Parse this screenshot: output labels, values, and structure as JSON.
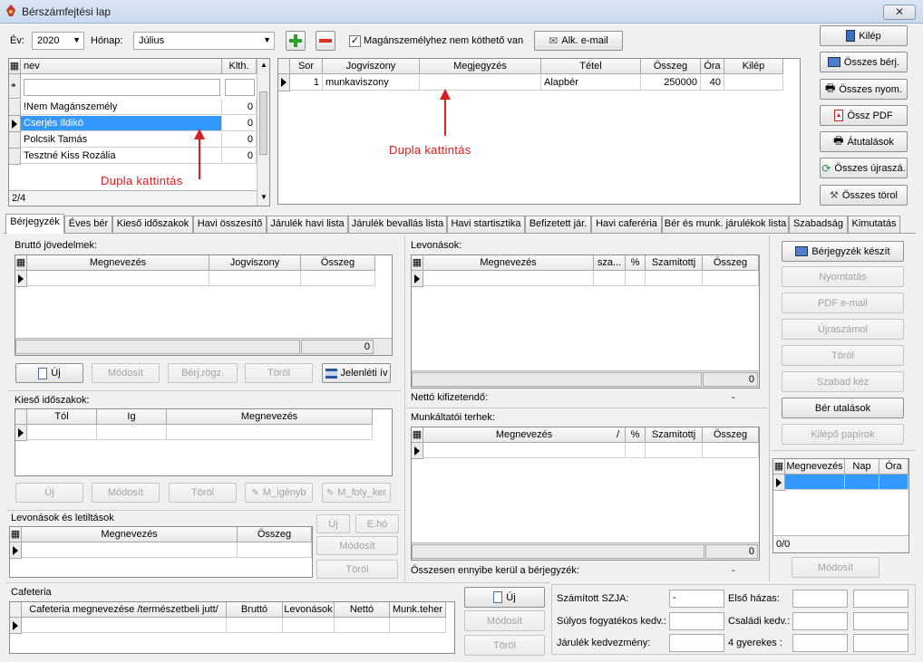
{
  "window": {
    "title": "Bérszámfejtési lap",
    "close_label": "✕"
  },
  "top": {
    "year_label": "Év:",
    "year_value": "2020",
    "month_label": "Hónap:",
    "month_value": "Július",
    "checkbox_label": "Magánszemélyhez nem köthető van",
    "email_button": "Alk. e-mail"
  },
  "right_buttons": {
    "exit": "Kilép",
    "all_payslips": "Összes bérj.",
    "all_print": "Összes nyom.",
    "all_pdf": "Össz PDF",
    "transfers": "Átutalások",
    "all_recalc": "Összes újraszá.",
    "all_delete": "Összes törol"
  },
  "employees": {
    "columns": [
      "nev",
      "Klth."
    ],
    "rows": [
      {
        "name": "!Nem Magánszemély",
        "klth": "0"
      },
      {
        "name": "Cserjés Ildikó",
        "klth": "0"
      },
      {
        "name": "Polcsik Tamás",
        "klth": "0"
      },
      {
        "name": "Tesztné Kiss Rozália",
        "klth": "0"
      }
    ],
    "footer": "2/4"
  },
  "items": {
    "columns": [
      "Sor",
      "Jogviszony",
      "Megjegyzés",
      "Tétel",
      "Összeg",
      "Óra",
      "Kilép"
    ],
    "rows": [
      {
        "sor": "1",
        "jogviszony": "munkaviszony",
        "megjegyzes": "",
        "tetel": "Alapbér",
        "osszeg": "250000",
        "ora": "40",
        "kilep": ""
      }
    ]
  },
  "annotations": {
    "left": "Dupla kattintás",
    "right": "Dupla kattintás"
  },
  "tabs": [
    "Bérjegyzék",
    "Éves bér",
    "Kieső időszakok",
    "Havi összesítő",
    "Járulék havi lista",
    "Járulék bevallás lista",
    "Havi startisztika",
    "Befizetett jár.",
    "Havi caferéria",
    "Bér és munk. járulékok lista",
    "Szabadság",
    "Kimutatás"
  ],
  "gross": {
    "title": "Bruttó jövedelmek:",
    "columns": [
      "Megnevezés",
      "Jogviszony",
      "Összeg"
    ],
    "total": "0",
    "buttons": {
      "new": "Új",
      "modify": "Módosít",
      "berj": "Bérj.rögz.",
      "delete": "Töröl",
      "attendance": "Jelenléti ív"
    }
  },
  "absence": {
    "title": "Kieső időszakok:",
    "columns": [
      "Tól",
      "Ig",
      "Megnevezés"
    ],
    "buttons": {
      "new": "Új",
      "modify": "Módosít",
      "delete": "Töröl",
      "m_igeny": "M_igényb",
      "m_foly": "M_foly_ker"
    }
  },
  "deduct_small": {
    "title": "Levonások és letiltások",
    "columns": [
      "Megnevezés",
      "Összeg"
    ],
    "buttons": {
      "new": "Új",
      "eho": "E.hó",
      "modify": "Módosít",
      "delete": "Töröl"
    }
  },
  "cafeteria": {
    "title": "Cafeteria",
    "columns": [
      "Cafeteria megnevezése /természetbeli jutt/",
      "Bruttó",
      "Levonások",
      "Nettó",
      "Munk.teher"
    ],
    "buttons": {
      "new": "Új",
      "modify": "Módosít",
      "delete": "Töröl"
    }
  },
  "deductions": {
    "title": "Levonások:",
    "columns": [
      "Megnevezés",
      "sza...",
      "%",
      "Szamitottj",
      "Összeg"
    ],
    "total": "0",
    "net_label": "Nettó kifizetendő:",
    "net_value": "-"
  },
  "employer": {
    "title": "Munkáltatói terhek:",
    "columns": [
      "Megnevezés",
      "/",
      "%",
      "Szamitottj",
      "Összeg"
    ],
    "total": "0",
    "sum_label": "Összesen ennyibe kerül a bérjegyzék:",
    "sum_value": "-"
  },
  "actions": {
    "create": "Bérjegyzék készít",
    "print": "Nyomtatás",
    "pdf_email": "PDF e-mail",
    "recalc": "Újraszámol",
    "delete": "Töröl",
    "free": "Szabad kéz",
    "transfers": "Bér utalások",
    "exit_papers": "Kilépő papírok"
  },
  "leave": {
    "columns": [
      "Megnevezés",
      "Nap",
      "Óra"
    ],
    "footer": "0/0",
    "modify": "Módosít"
  },
  "summary": {
    "szja_label": "Számított SZJA:",
    "szja_value": "-",
    "disabled_label": "Súlyos fogyatékos kedv.:",
    "jarulek_label": "Járulék kedvezmény:",
    "first_marriage_label": "Első házas:",
    "family_label": "Családi kedv.:",
    "four_children_label": "4 gyerekes :"
  }
}
